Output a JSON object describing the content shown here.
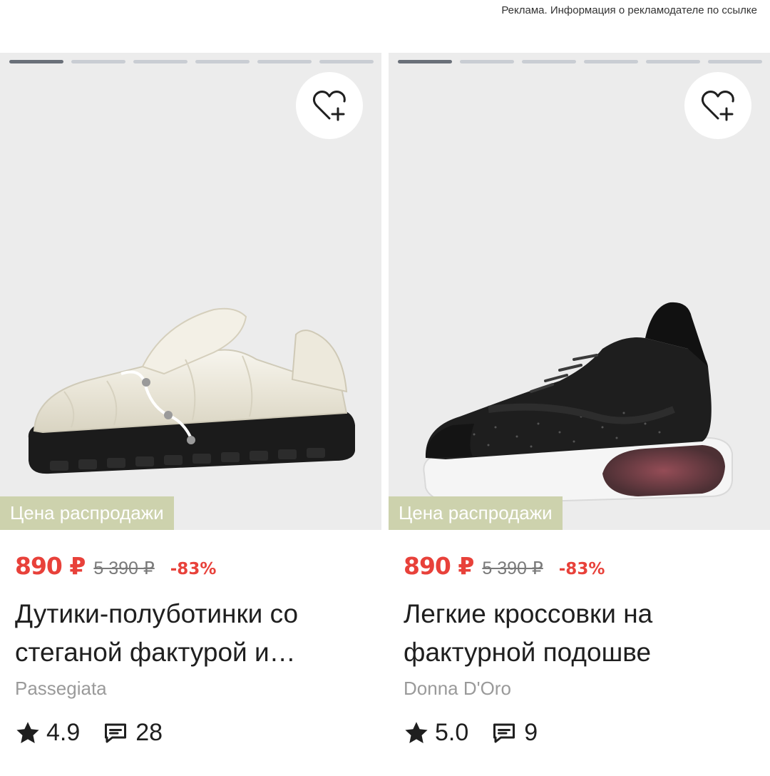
{
  "ad_notice": "Реклама. Информация о рекламодателе по ссылке",
  "products": [
    {
      "gallery": {
        "total": 6,
        "active": 1
      },
      "sale_badge": "Цена распродажи",
      "price": "890 ₽",
      "old_price": "5 390 ₽",
      "discount": "-83%",
      "title": "Дутики-полуботинки со стеганой фактурой и…",
      "brand": "Passegiata",
      "rating": "4.9",
      "reviews": "28",
      "icon_names": [
        "heart-plus-icon",
        "star-icon",
        "comment-icon"
      ]
    },
    {
      "gallery": {
        "total": 6,
        "active": 1
      },
      "sale_badge": "Цена распродажи",
      "price": "890 ₽",
      "old_price": "5 390 ₽",
      "discount": "-83%",
      "title": "Легкие кроссовки на фактурной подошве",
      "brand": "Donna D'Oro",
      "rating": "5.0",
      "reviews": "9",
      "icon_names": [
        "heart-plus-icon",
        "star-icon",
        "comment-icon"
      ]
    }
  ],
  "colors": {
    "price_red": "#e8413a",
    "sale_badge_bg": "#cdd2ad",
    "image_bg": "#ececec",
    "brand_gray": "#9a9a9a"
  }
}
